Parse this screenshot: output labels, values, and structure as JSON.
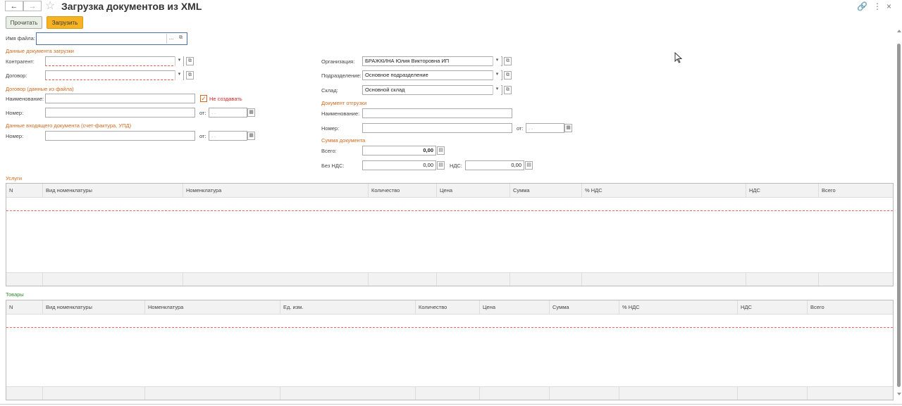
{
  "header": {
    "title": "Загрузка документов из XML",
    "back_icon": "←",
    "forward_icon": "→",
    "star_icon": "☆",
    "link_icon": "🔗",
    "menu_icon": "⋮",
    "close_icon": "×"
  },
  "toolbar": {
    "read_label": "Прочитать",
    "load_label": "Загрузить"
  },
  "file": {
    "label": "Имя файла:",
    "value": "",
    "choose": "..."
  },
  "load_doc": {
    "section": "Данные документа загрузки",
    "counterparty_label": "Контрагент:",
    "counterparty_value": "",
    "contract_label": "Договор:",
    "contract_value": ""
  },
  "contract_file": {
    "section": "Договор (данные из файла)",
    "name_label": "Наименование:",
    "name_value": "",
    "dont_create_label": "Не создавать",
    "dont_create_checked": true,
    "number_label": "Номер:",
    "number_value": "",
    "date_label": "от:",
    "date_value": ". .  "
  },
  "incoming_doc": {
    "section": "Данные входящего документа (счет-фактура, УПД)",
    "number_label": "Номер:",
    "number_value": "",
    "date_label": "от:",
    "date_value": ". .  "
  },
  "org": {
    "organization_label": "Организация:",
    "organization_value": "БРАЖКИНА Юлия Викторовна ИП",
    "division_label": "Подразделение:",
    "division_value": "Основное подразделение",
    "warehouse_label": "Склад:",
    "warehouse_value": "Основной склад"
  },
  "shipment_doc": {
    "section": "Документ отгрузки",
    "name_label": "Наименование:",
    "name_value": "",
    "number_label": "Номер:",
    "number_value": "",
    "date_label": "от:",
    "date_value": ". .  "
  },
  "doc_sum": {
    "section": "Сумма документа",
    "total_label": "Всего:",
    "total_value": "0,00",
    "without_vat_label": "Без НДС:",
    "without_vat_value": "0,00",
    "vat_label": "НДС:",
    "vat_value": "0,00"
  },
  "services": {
    "section": "Услуги",
    "columns": [
      "N",
      "Вид номенклатуры",
      "Номенклатура",
      "Количество",
      "Цена",
      "Сумма",
      "% НДС",
      "НДС",
      "Всего"
    ]
  },
  "goods": {
    "section": "Товары",
    "columns": [
      "N",
      "Вид номенклатуры",
      "Номенклатура",
      "Ед. изм.",
      "Количество",
      "Цена",
      "Сумма",
      "% НДС",
      "НДС",
      "Всего"
    ]
  },
  "icons": {
    "dropdown": "▾",
    "open": "⧉",
    "calendar": "▦",
    "calculator": "▤",
    "check": "✓"
  }
}
